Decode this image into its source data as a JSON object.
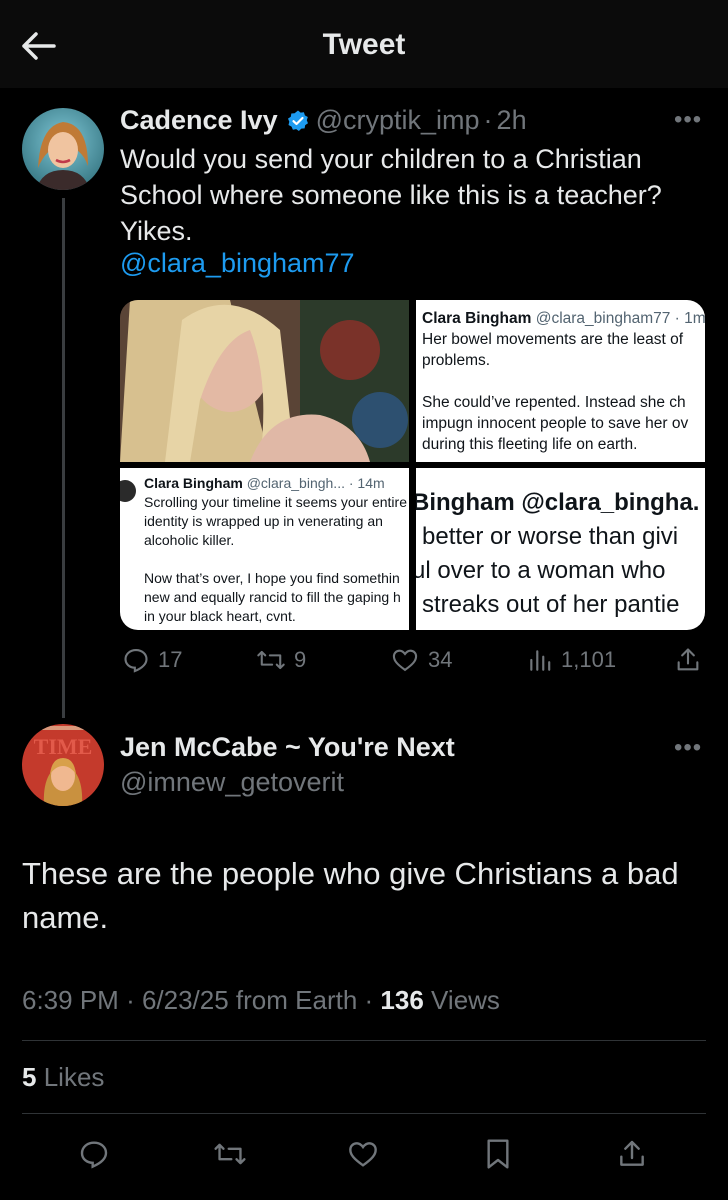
{
  "header": {
    "title": "Tweet"
  },
  "quoted_tweet": {
    "author_name": "Cadence Ivy",
    "handle": "@cryptik_imp",
    "separator": "·",
    "time": "2h",
    "text": "Would you send your children to a Christian School where someone like this is a teacher? Yikes.",
    "mention": "@clara_bingham77",
    "media": {
      "shot_top_right": {
        "name": "Clara Bingham",
        "meta": "@clara_bingham77 · 1m",
        "line1": "Her bowel movements are the least of",
        "line2": "problems.",
        "line3": "She could’ve repented. Instead she ch",
        "line4": "impugn innocent people to save her ov",
        "line5": "during this fleeting life on earth."
      },
      "shot_bottom_left": {
        "name": "Clara Bingham",
        "meta": "@clara_bingh... · 14m",
        "line1": "Scrolling your timeline it seems your entire",
        "line2": "identity is wrapped up in venerating an",
        "line3": "alcoholic killer.",
        "line4": "Now that’s over, I hope you find somethin",
        "line5": "new and equally rancid to fill the gaping h",
        "line6": "in your black heart, cvnt."
      },
      "shot_bottom_right": {
        "line1": "Bingham @clara_bingha.",
        "line2": "better or worse than givi",
        "line3": "ul over to a woman who",
        "line4": "streaks out of her pantie"
      }
    },
    "actions": {
      "replies": "17",
      "retweets": "9",
      "likes": "34",
      "views": "1,101"
    }
  },
  "reply": {
    "author_name": "Jen McCabe ~ You're Next",
    "handle": "@imnew_getoverit",
    "text": "These are the people who give Christians a bad name.",
    "time": "6:39 PM",
    "date": "6/23/25 from Earth",
    "views_count": "136",
    "views_label": "Views",
    "likes_count": "5",
    "likes_label": "Likes",
    "avatar_text": "TIME"
  },
  "colors": {
    "background": "#000000",
    "link": "#1d9bf0",
    "muted": "#71767b",
    "text": "#e7e9ea",
    "verified": "#1d9bf0"
  }
}
